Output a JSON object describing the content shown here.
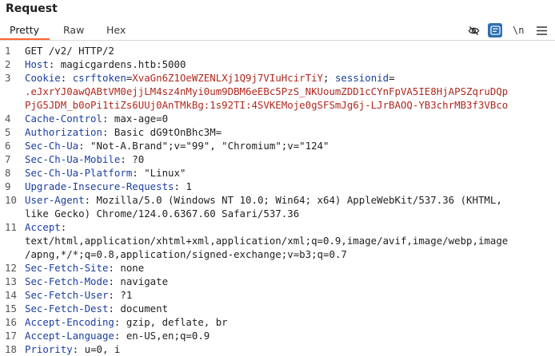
{
  "panel": {
    "title": "Request",
    "tabs": [
      "Pretty",
      "Raw",
      "Hex"
    ],
    "active_tab": "Pretty",
    "newline_toggle": "\\n",
    "accent": "#ff6633",
    "tool_active_bg": "#2e6fb0"
  },
  "lines": [
    {
      "n": "1",
      "parts": [
        {
          "t": "GET /v2/ HTTP/2",
          "c": ""
        }
      ]
    },
    {
      "n": "2",
      "parts": [
        {
          "t": "Host",
          "c": "k"
        },
        {
          "t": ": magicgardens.htb:5000",
          "c": ""
        }
      ]
    },
    {
      "n": "3",
      "parts": [
        {
          "t": "Cookie",
          "c": "k"
        },
        {
          "t": ": ",
          "c": ""
        },
        {
          "t": "csrftoken",
          "c": "b"
        },
        {
          "t": "=",
          "c": ""
        },
        {
          "t": "XvaGn6Z1OeWZENLXj1Q9j7VIuHcirTiY",
          "c": "r"
        },
        {
          "t": "; ",
          "c": ""
        },
        {
          "t": "sessionid",
          "c": "b"
        },
        {
          "t": "=",
          "c": ""
        }
      ]
    },
    {
      "n": "",
      "parts": [
        {
          "t": ".eJxrYJ0awQABtVM0ejjLM4sz4nMyi0um9DBM6eEBc5PzS_NKUoumZDD1cCYnFpVA5IE8HjAPSZqruDQp",
          "c": "r"
        }
      ]
    },
    {
      "n": "",
      "parts": [
        {
          "t": "PjG5JDM_b0oPi1tiZs6UUj0AnTMkBg:1s92TI:4SVKEMoje0gSFSmJg6j-LJrBAOQ-YB3chrMB3f3VBco",
          "c": "r"
        }
      ]
    },
    {
      "n": "4",
      "parts": [
        {
          "t": "Cache-Control",
          "c": "k"
        },
        {
          "t": ": max-age=0",
          "c": ""
        }
      ]
    },
    {
      "n": "5",
      "parts": [
        {
          "t": "Authorization",
          "c": "k"
        },
        {
          "t": ": Basic dG9tOnBhc3M=",
          "c": ""
        }
      ]
    },
    {
      "n": "6",
      "parts": [
        {
          "t": "Sec-Ch-Ua",
          "c": "k"
        },
        {
          "t": ": \"Not-A.Brand\";v=\"99\", \"Chromium\";v=\"124\"",
          "c": ""
        }
      ]
    },
    {
      "n": "7",
      "parts": [
        {
          "t": "Sec-Ch-Ua-Mobile",
          "c": "k"
        },
        {
          "t": ": ?0",
          "c": ""
        }
      ]
    },
    {
      "n": "8",
      "parts": [
        {
          "t": "Sec-Ch-Ua-Platform",
          "c": "k"
        },
        {
          "t": ": \"Linux\"",
          "c": ""
        }
      ]
    },
    {
      "n": "9",
      "parts": [
        {
          "t": "Upgrade-Insecure-Requests",
          "c": "k"
        },
        {
          "t": ": 1",
          "c": ""
        }
      ]
    },
    {
      "n": "10",
      "parts": [
        {
          "t": "User-Agent",
          "c": "k"
        },
        {
          "t": ": Mozilla/5.0 (Windows NT 10.0; Win64; x64) AppleWebKit/537.36 (KHTML,",
          "c": ""
        }
      ]
    },
    {
      "n": "",
      "parts": [
        {
          "t": "like Gecko) Chrome/124.0.6367.60 Safari/537.36",
          "c": ""
        }
      ]
    },
    {
      "n": "11",
      "parts": [
        {
          "t": "Accept",
          "c": "k"
        },
        {
          "t": ":",
          "c": ""
        }
      ]
    },
    {
      "n": "",
      "parts": [
        {
          "t": "text/html,application/xhtml+xml,application/xml;q=0.9,image/avif,image/webp,image",
          "c": ""
        }
      ]
    },
    {
      "n": "",
      "parts": [
        {
          "t": "/apng,*/*;q=0.8,application/signed-exchange;v=b3;q=0.7",
          "c": ""
        }
      ]
    },
    {
      "n": "12",
      "parts": [
        {
          "t": "Sec-Fetch-Site",
          "c": "k"
        },
        {
          "t": ": none",
          "c": ""
        }
      ]
    },
    {
      "n": "13",
      "parts": [
        {
          "t": "Sec-Fetch-Mode",
          "c": "k"
        },
        {
          "t": ": navigate",
          "c": ""
        }
      ]
    },
    {
      "n": "14",
      "parts": [
        {
          "t": "Sec-Fetch-User",
          "c": "k"
        },
        {
          "t": ": ?1",
          "c": ""
        }
      ]
    },
    {
      "n": "15",
      "parts": [
        {
          "t": "Sec-Fetch-Dest",
          "c": "k"
        },
        {
          "t": ": document",
          "c": ""
        }
      ]
    },
    {
      "n": "16",
      "parts": [
        {
          "t": "Accept-Encoding",
          "c": "k"
        },
        {
          "t": ": gzip, deflate, br",
          "c": ""
        }
      ]
    },
    {
      "n": "17",
      "parts": [
        {
          "t": "Accept-Language",
          "c": "k"
        },
        {
          "t": ": en-US,en;q=0.9",
          "c": ""
        }
      ]
    },
    {
      "n": "18",
      "parts": [
        {
          "t": "Priority",
          "c": "k"
        },
        {
          "t": ": u=0, i",
          "c": ""
        }
      ]
    }
  ]
}
